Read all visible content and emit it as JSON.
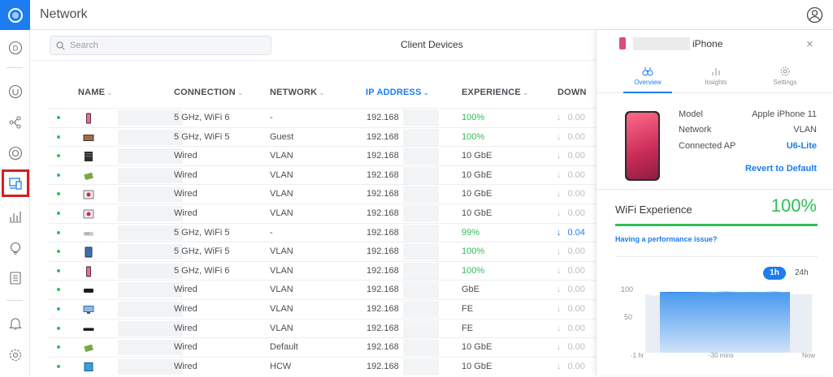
{
  "app": {
    "title": "Network",
    "logo_icon": "ubiquiti-logo-icon",
    "user_icon": "user-avatar-icon"
  },
  "sidebar": {
    "items": [
      {
        "name": "dashboard",
        "icon": "dashboard-icon"
      },
      {
        "name": "unifi-devices",
        "icon": "unifi-devices-icon"
      },
      {
        "name": "topology",
        "icon": "topology-icon"
      },
      {
        "name": "ubiquiti-devices",
        "icon": "devices-circle-icon"
      },
      {
        "name": "client-devices",
        "icon": "client-devices-icon",
        "active": true
      },
      {
        "name": "statistics",
        "icon": "statistics-icon"
      },
      {
        "name": "insights",
        "icon": "insights-bulb-icon"
      },
      {
        "name": "system-log",
        "icon": "system-log-icon"
      },
      {
        "name": "notifications",
        "icon": "bell-icon"
      },
      {
        "name": "settings",
        "icon": "gear-icon"
      }
    ]
  },
  "main": {
    "search_placeholder": "Search",
    "title": "Client Devices",
    "columns": [
      "NAME",
      "CONNECTION",
      "NETWORK",
      "IP ADDRESS",
      "EXPERIENCE",
      "DOWN"
    ],
    "active_column": "IP ADDRESS",
    "rows": [
      {
        "icon": "iphone-pink-icon",
        "connection": "5 GHz, WiFi 6",
        "network": "-",
        "ip": "192.168",
        "experience": "100%",
        "exp_good": true,
        "down": "0.00"
      },
      {
        "icon": "tv-icon",
        "connection": "5 GHz, WiFi 5",
        "network": "Guest",
        "ip": "192.168",
        "experience": "100%",
        "exp_good": true,
        "down": "0.00"
      },
      {
        "icon": "nas-icon",
        "connection": "Wired",
        "network": "VLAN",
        "ip": "192.168",
        "experience": "10 GbE",
        "exp_good": false,
        "down": "0.00"
      },
      {
        "icon": "raspberry-pi-icon",
        "connection": "Wired",
        "network": "VLAN",
        "ip": "192.168",
        "experience": "10 GbE",
        "exp_good": false,
        "down": "0.00"
      },
      {
        "icon": "camera-icon",
        "connection": "Wired",
        "network": "VLAN",
        "ip": "192.168",
        "experience": "10 GbE",
        "exp_good": false,
        "down": "0.00"
      },
      {
        "icon": "camera-icon",
        "connection": "Wired",
        "network": "VLAN",
        "ip": "192.168",
        "experience": "10 GbE",
        "exp_good": false,
        "down": "0.00"
      },
      {
        "icon": "router-icon",
        "connection": "5 GHz, WiFi 5",
        "network": "-",
        "ip": "192.168",
        "experience": "99%",
        "exp_good": true,
        "down": "0.04",
        "down_active": true
      },
      {
        "icon": "ipad-icon",
        "connection": "5 GHz, WiFi 5",
        "network": "VLAN",
        "ip": "192.168",
        "experience": "100%",
        "exp_good": true,
        "down": "0.00"
      },
      {
        "icon": "iphone-pink-icon",
        "connection": "5 GHz, WiFi 6",
        "network": "VLAN",
        "ip": "192.168",
        "experience": "100%",
        "exp_good": true,
        "down": "0.00"
      },
      {
        "icon": "apple-tv-icon",
        "connection": "Wired",
        "network": "VLAN",
        "ip": "192.168",
        "experience": "GbE",
        "exp_good": false,
        "down": "0.00"
      },
      {
        "icon": "display-icon",
        "connection": "Wired",
        "network": "VLAN",
        "ip": "192.168",
        "experience": "FE",
        "exp_good": false,
        "down": "0.00"
      },
      {
        "icon": "switch-icon",
        "connection": "Wired",
        "network": "VLAN",
        "ip": "192.168",
        "experience": "FE",
        "exp_good": false,
        "down": "0.00"
      },
      {
        "icon": "raspberry-pi-icon",
        "connection": "Wired",
        "network": "Default",
        "ip": "192.168",
        "experience": "10 GbE",
        "exp_good": false,
        "down": "0.00"
      },
      {
        "icon": "monitor-icon",
        "connection": "Wired",
        "network": "HCW",
        "ip": "192.168",
        "experience": "10 GbE",
        "exp_good": false,
        "down": "0.00"
      }
    ]
  },
  "panel": {
    "device_name": "iPhone",
    "close_icon": "close-icon",
    "tabs": [
      {
        "label": "Overview",
        "icon": "binoculars-icon",
        "active": true
      },
      {
        "label": "Insights",
        "icon": "bar-chart-icon"
      },
      {
        "label": "Settings",
        "icon": "gear-icon"
      }
    ],
    "details": [
      {
        "key": "Model",
        "value": "Apple iPhone 11"
      },
      {
        "key": "Network",
        "value": "VLAN"
      },
      {
        "key": "Connected AP",
        "value": "U6-Lite",
        "link": true
      }
    ],
    "revert_label": "Revert to Default",
    "wifi_experience_label": "WiFi Experience",
    "wifi_experience_value": "100%",
    "wifi_experience_level": 1.0,
    "performance_link": "Having a performance issue?",
    "range_1h": "1h",
    "range_24h": "24h",
    "chart_y_labels": [
      "100",
      "50"
    ],
    "chart_x_labels": [
      "-1 hr",
      "-30 mins",
      "Now"
    ]
  },
  "colors": {
    "accent": "#1c7cf0",
    "good": "#2fbf55",
    "phone": "#d74d7c"
  }
}
